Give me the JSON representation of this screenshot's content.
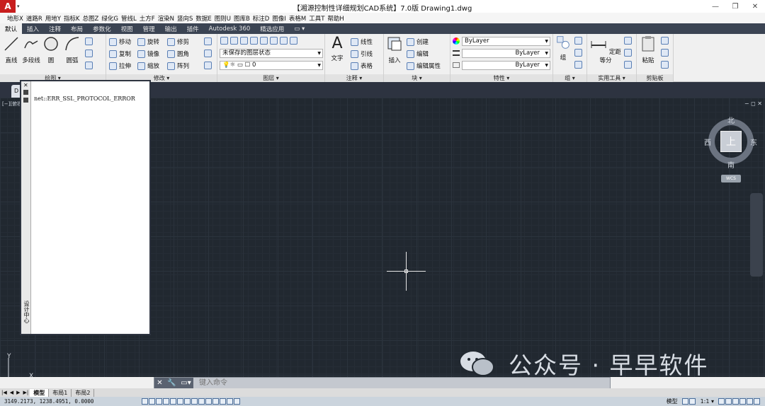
{
  "window": {
    "title": "【湘源控制性详细规划CAD系统】7.0版    Drawing1.dwg",
    "logo": "A",
    "minimize": "—",
    "restore": "❐",
    "close": "✕"
  },
  "menu": [
    "地形X",
    "道路R",
    "用地Y",
    "指标K",
    "总图Z",
    "绿化G",
    "管线L",
    "土方F",
    "渲染N",
    "竖向S",
    "数据E",
    "图则U",
    "图库B",
    "标注D",
    "图像I",
    "表格M",
    "工具T",
    "帮助H"
  ],
  "ribbon_tabs": [
    "默认",
    "插入",
    "注释",
    "布局",
    "参数化",
    "视图",
    "管理",
    "输出",
    "插件",
    "Autodesk 360",
    "精选应用",
    "▭ ▾"
  ],
  "draw": {
    "title": "绘图 ▾",
    "line": "直线",
    "polyline": "多段线",
    "circle": "圆",
    "arc": "圆弧"
  },
  "modify": {
    "title": "修改 ▾",
    "move": "移动",
    "rotate": "旋转",
    "trim": "修剪",
    "copy": "复制",
    "mirror": "镜像",
    "fillet": "圆角",
    "stretch": "拉伸",
    "scale": "缩放",
    "array": "阵列"
  },
  "layers": {
    "title": "图层 ▾",
    "state": "未保存的图层状态",
    "current": "0"
  },
  "annotation": {
    "title": "注释 ▾",
    "text": "文字",
    "linear": "线性",
    "leader": "引线",
    "table": "表格"
  },
  "block": {
    "title": "块 ▾",
    "insert": "插入",
    "create": "创建",
    "edit": "编辑",
    "edit_attr": "编辑属性"
  },
  "properties": {
    "title": "特性 ▾",
    "color": "ByLayer",
    "linetype": "ByLayer",
    "lineweight": "ByLayer"
  },
  "group": {
    "title": "组 ▾",
    "group": "组"
  },
  "utilities": {
    "title": "实用工具 ▾",
    "measure": "定距等分"
  },
  "clipboard": {
    "title": "剪贴板",
    "paste": "粘贴"
  },
  "doc_tab": "D",
  "viewport": {
    "label": "[−][俯视]",
    "controls": "−  ◻  ✕"
  },
  "viewcube": {
    "top": "上",
    "north": "北",
    "south": "南",
    "east": "东",
    "west": "西",
    "wcs": "WCS"
  },
  "palette": {
    "error": "net::ERR_SSL_PROTOCOL_ERROR",
    "vlabel": "设计中心",
    "close": "✕"
  },
  "ucs": {
    "x": "X",
    "y": "Y"
  },
  "watermark": {
    "text": "公众号 · 早早软件"
  },
  "command": {
    "placeholder": "键入命令",
    "close": "✕",
    "wrench": "🔧"
  },
  "layout_tabs": {
    "model": "模型",
    "layout1": "布局1",
    "layout2": "布局2"
  },
  "status": {
    "coords": "3149.2173, 1238.4951, 0.0000",
    "model": "模型",
    "scale": "1:1 ▾"
  },
  "colors": {
    "accent": "#3b4453",
    "canvas": "#212830"
  }
}
